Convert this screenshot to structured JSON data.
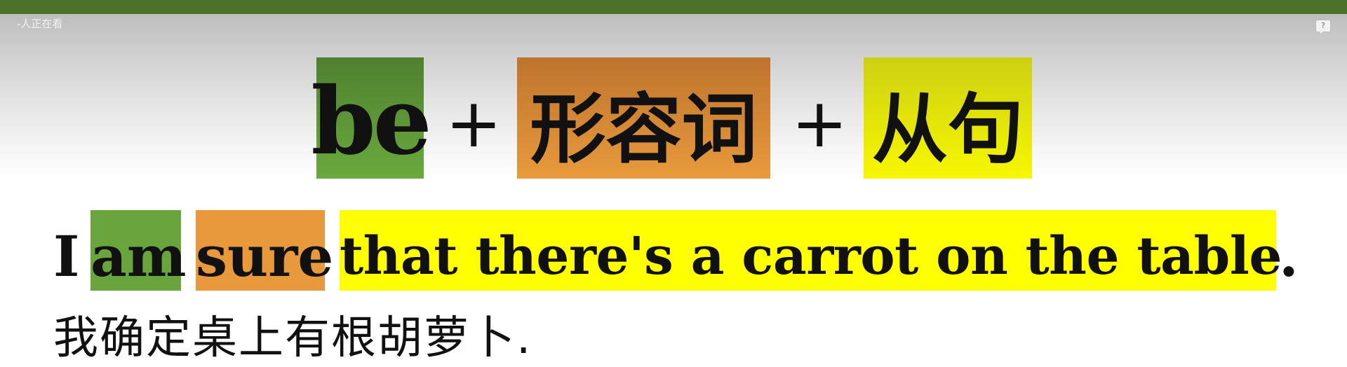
{
  "header": {
    "viewer_count": "-人正在看",
    "help_label": "?"
  },
  "formula": {
    "be": "be",
    "plus_1": "+",
    "adjective": "形容词",
    "plus_2": "+",
    "clause": "从句"
  },
  "sentence": {
    "subject": "I",
    "verb": "am",
    "adjective": "sure",
    "clause": "that there's a carrot on the table",
    "period": "."
  },
  "translation": "我确定桌上有根胡萝卜.",
  "colors": {
    "top_bar": "#4a7329",
    "be_highlight": "#69a53c",
    "adjective_highlight": "#e8993b",
    "clause_highlight": "#ffff00"
  }
}
